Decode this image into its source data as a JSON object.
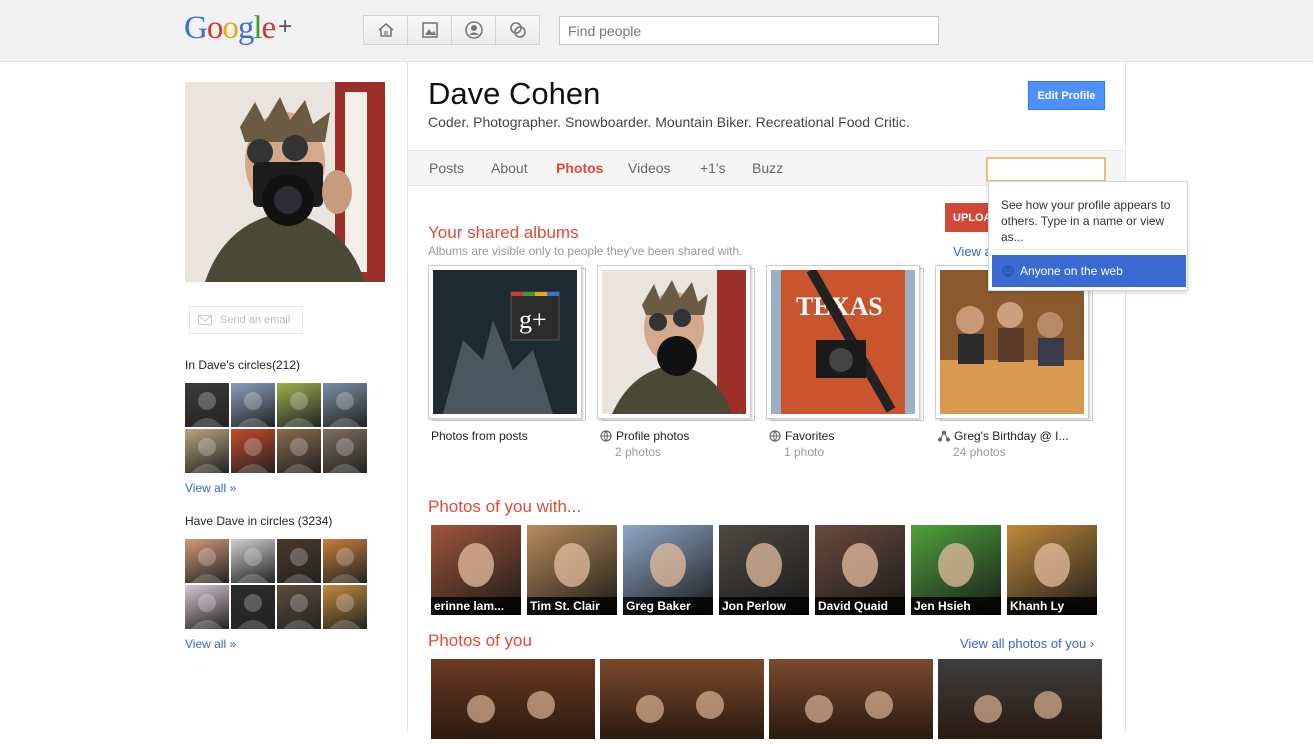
{
  "topbar": {
    "logo": {
      "g1": "G",
      "o1": "o",
      "o2": "o",
      "g2": "g",
      "l": "l",
      "e": "e",
      "plus": "+"
    },
    "nav_icons": [
      "home-icon",
      "photos-icon",
      "profile-icon",
      "circles-icon"
    ],
    "search_placeholder": "Find people"
  },
  "profile": {
    "name": "Dave Cohen",
    "tagline": "Coder. Photographer. Snowboarder. Mountain Biker. Recreational Food Critic.",
    "edit_label": "Edit Profile",
    "send_email_label": "Send an email"
  },
  "tabs": [
    {
      "label": "Posts",
      "active": false
    },
    {
      "label": "About",
      "active": false
    },
    {
      "label": "Photos",
      "active": true
    },
    {
      "label": "Videos",
      "active": false
    },
    {
      "label": "+1's",
      "active": false
    },
    {
      "label": "Buzz",
      "active": false
    }
  ],
  "view_as_popup": {
    "text": "See how your profile appears to others. Type in a name or view as...",
    "option": "Anyone on the web"
  },
  "circles": {
    "in_circles_title": "In Dave's circles(212)",
    "have_in_circles_title": "Have Dave in circles (3234)",
    "view_all": "View all »",
    "in_colors": [
      "#3c3c3c",
      "#8a9fc2",
      "#9db04f",
      "#7a8fa6",
      "#b9a47e",
      "#c34a2b",
      "#8b6b4d",
      "#7f6f5e"
    ],
    "have_colors": [
      "#d39a79",
      "#cfcfcf",
      "#4a3a2a",
      "#c87d3c",
      "#d8c7d2",
      "#2b2b2b",
      "#5c4e3c",
      "#c28a3f"
    ]
  },
  "shared_albums": {
    "title": "Your shared albums",
    "subtitle": "Albums are visible only to people they've been shared with.",
    "upload_label": "UPLOAD",
    "view_link": "View a",
    "albums": [
      {
        "title": "Photos from posts",
        "count": "",
        "icon": "",
        "color": "#2d3b44"
      },
      {
        "title": "Profile photos",
        "count": "2 photos",
        "icon": "globe-icon",
        "color": "#6f5847"
      },
      {
        "title": "Favorites",
        "count": "1 photo",
        "icon": "globe-icon",
        "color": "#c8552e"
      },
      {
        "title": "Greg's Birthday @ I...",
        "count": "24 photos",
        "icon": "share-icon",
        "color": "#8a5a2e"
      }
    ]
  },
  "photos_with": {
    "title": "Photos of you with...",
    "people": [
      {
        "name": "erinne lam...",
        "color": "#a0553a"
      },
      {
        "name": "Tim St. Clair",
        "color": "#b98c5a"
      },
      {
        "name": "Greg Baker",
        "color": "#8fa8c8"
      },
      {
        "name": "Jon Perlow",
        "color": "#4e4a44"
      },
      {
        "name": "David Quaid",
        "color": "#6a4b3c"
      },
      {
        "name": "Jen Hsieh",
        "color": "#4ea33b"
      },
      {
        "name": "Khanh Ly",
        "color": "#c08a3a"
      }
    ]
  },
  "photos_of_you": {
    "title": "Photos of you",
    "view_all": "View all photos of you ›",
    "colors": [
      "#6b3a22",
      "#7a4a2c",
      "#7b4b2f",
      "#3e3e3e"
    ]
  }
}
